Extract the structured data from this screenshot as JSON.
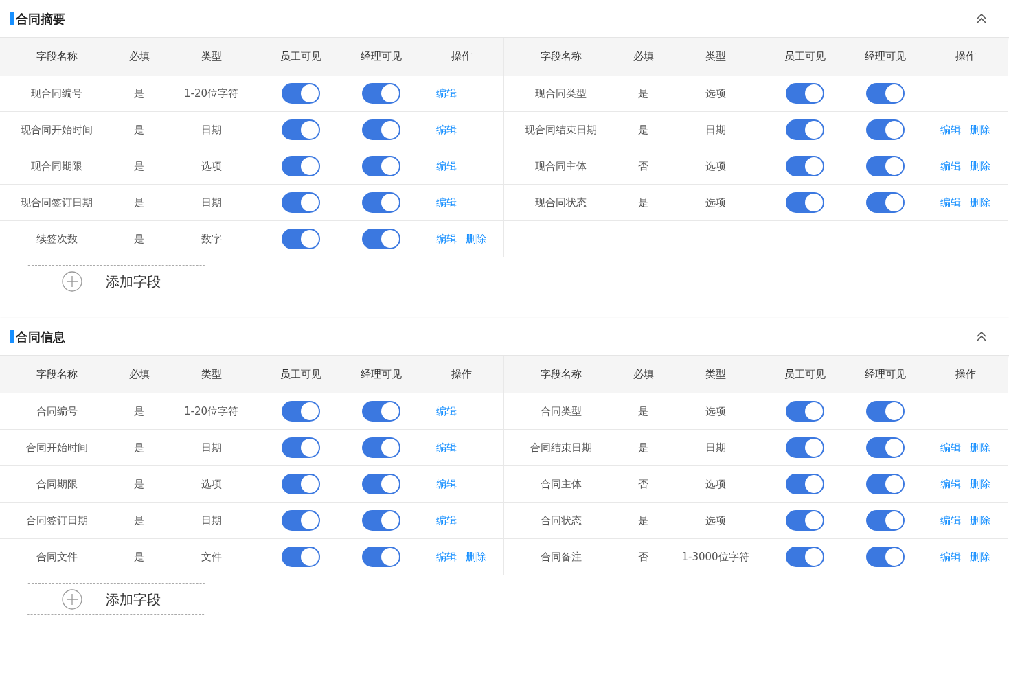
{
  "sections": [
    {
      "title": "合同摘要",
      "expanded": true,
      "tables": [
        {
          "columns": [
            "字段名称",
            "必填",
            "类型",
            "员工可见",
            "经理可见",
            "操作"
          ],
          "rows": [
            {
              "name": "现合同编号",
              "required": "是",
              "type": "1-20位字符",
              "employee_visible": true,
              "manager_visible": true,
              "actions": [
                "编辑"
              ]
            },
            {
              "name": "现合同开始时间",
              "required": "是",
              "type": "日期",
              "employee_visible": true,
              "manager_visible": true,
              "actions": [
                "编辑"
              ]
            },
            {
              "name": "现合同期限",
              "required": "是",
              "type": "选项",
              "employee_visible": true,
              "manager_visible": true,
              "actions": [
                "编辑"
              ]
            },
            {
              "name": "现合同签订日期",
              "required": "是",
              "type": "日期",
              "employee_visible": true,
              "manager_visible": true,
              "actions": [
                "编辑"
              ]
            },
            {
              "name": "续签次数",
              "required": "是",
              "type": "数字",
              "employee_visible": true,
              "manager_visible": true,
              "actions": [
                "编辑",
                "删除"
              ]
            }
          ]
        },
        {
          "columns": [
            "字段名称",
            "必填",
            "类型",
            "员工可见",
            "经理可见",
            "操作"
          ],
          "rows": [
            {
              "name": "现合同类型",
              "required": "是",
              "type": "选项",
              "employee_visible": true,
              "manager_visible": true,
              "actions": []
            },
            {
              "name": "现合同结束日期",
              "required": "是",
              "type": "日期",
              "employee_visible": true,
              "manager_visible": true,
              "actions": [
                "编辑",
                "删除"
              ]
            },
            {
              "name": "现合同主体",
              "required": "否",
              "type": "选项",
              "employee_visible": true,
              "manager_visible": true,
              "actions": [
                "编辑",
                "删除"
              ]
            },
            {
              "name": "现合同状态",
              "required": "是",
              "type": "选项",
              "employee_visible": true,
              "manager_visible": true,
              "actions": [
                "编辑",
                "删除"
              ]
            }
          ]
        }
      ],
      "add_button": "添加字段"
    },
    {
      "title": "合同信息",
      "expanded": true,
      "tables": [
        {
          "columns": [
            "字段名称",
            "必填",
            "类型",
            "员工可见",
            "经理可见",
            "操作"
          ],
          "rows": [
            {
              "name": "合同编号",
              "required": "是",
              "type": "1-20位字符",
              "employee_visible": true,
              "manager_visible": true,
              "actions": [
                "编辑"
              ]
            },
            {
              "name": "合同开始时间",
              "required": "是",
              "type": "日期",
              "employee_visible": true,
              "manager_visible": true,
              "actions": [
                "编辑"
              ]
            },
            {
              "name": "合同期限",
              "required": "是",
              "type": "选项",
              "employee_visible": true,
              "manager_visible": true,
              "actions": [
                "编辑"
              ]
            },
            {
              "name": "合同签订日期",
              "required": "是",
              "type": "日期",
              "employee_visible": true,
              "manager_visible": true,
              "actions": [
                "编辑"
              ]
            },
            {
              "name": "合同文件",
              "required": "是",
              "type": "文件",
              "employee_visible": true,
              "manager_visible": true,
              "actions": [
                "编辑",
                "删除"
              ]
            }
          ]
        },
        {
          "columns": [
            "字段名称",
            "必填",
            "类型",
            "员工可见",
            "经理可见",
            "操作"
          ],
          "rows": [
            {
              "name": "合同类型",
              "required": "是",
              "type": "选项",
              "employee_visible": true,
              "manager_visible": true,
              "actions": []
            },
            {
              "name": "合同结束日期",
              "required": "是",
              "type": "日期",
              "employee_visible": true,
              "manager_visible": true,
              "actions": [
                "编辑",
                "删除"
              ]
            },
            {
              "name": "合同主体",
              "required": "否",
              "type": "选项",
              "employee_visible": true,
              "manager_visible": true,
              "actions": [
                "编辑",
                "删除"
              ]
            },
            {
              "name": "合同状态",
              "required": "是",
              "type": "选项",
              "employee_visible": true,
              "manager_visible": true,
              "actions": [
                "编辑",
                "删除"
              ]
            },
            {
              "name": "合同备注",
              "required": "否",
              "type": "1-3000位字符",
              "employee_visible": true,
              "manager_visible": true,
              "actions": [
                "编辑",
                "删除"
              ]
            }
          ]
        }
      ],
      "add_button": "添加字段"
    }
  ]
}
